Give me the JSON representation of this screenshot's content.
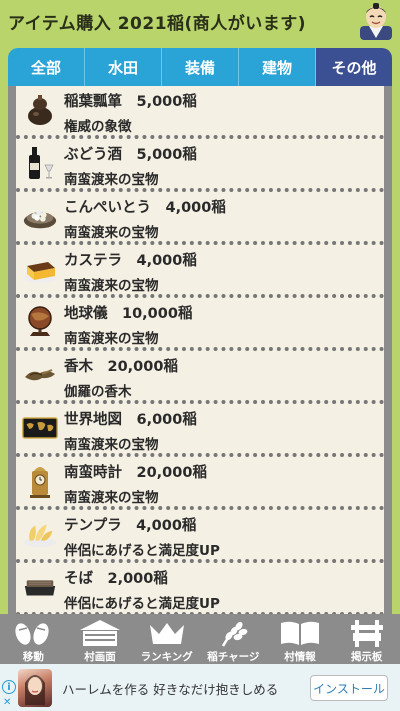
{
  "header": {
    "title": "アイテム購入 2021稲(商人がいます)"
  },
  "tabs": [
    {
      "label": "全部",
      "active": false
    },
    {
      "label": "水田",
      "active": false
    },
    {
      "label": "装備",
      "active": false
    },
    {
      "label": "建物",
      "active": false
    },
    {
      "label": "その他",
      "active": true
    }
  ],
  "items": [
    {
      "name": "稲葉瓢箪　5,000稲",
      "desc": "権威の象徴",
      "icon": "gourd-icon"
    },
    {
      "name": "ぶどう酒　5,000稲",
      "desc": "南蛮渡来の宝物",
      "icon": "wine-icon"
    },
    {
      "name": "こんぺいとう　4,000稲",
      "desc": "南蛮渡来の宝物",
      "icon": "konpeito-icon"
    },
    {
      "name": "カステラ　4,000稲",
      "desc": "南蛮渡来の宝物",
      "icon": "castella-icon"
    },
    {
      "name": "地球儀　10,000稲",
      "desc": "南蛮渡来の宝物",
      "icon": "globe-icon"
    },
    {
      "name": "香木　20,000稲",
      "desc": "伽羅の香木",
      "icon": "incense-wood-icon"
    },
    {
      "name": "世界地図　6,000稲",
      "desc": "南蛮渡来の宝物",
      "icon": "world-map-icon"
    },
    {
      "name": "南蛮時計　20,000稲",
      "desc": "南蛮渡来の宝物",
      "icon": "clock-icon"
    },
    {
      "name": "テンプラ　4,000稲",
      "desc": "伴侶にあげると満足度UP",
      "icon": "tempura-icon"
    },
    {
      "name": "そば　2,000稲",
      "desc": "伴侶にあげると満足度UP",
      "icon": "soba-icon"
    }
  ],
  "nav": [
    {
      "label": "移動",
      "icon": "move-icon"
    },
    {
      "label": "村画面",
      "icon": "village-icon"
    },
    {
      "label": "ランキング",
      "icon": "crown-icon"
    },
    {
      "label": "稲チャージ",
      "icon": "rice-icon"
    },
    {
      "label": "村情報",
      "icon": "book-icon"
    },
    {
      "label": "掲示板",
      "icon": "board-icon"
    }
  ],
  "ad": {
    "text": "ハーレムを作る 好きなだけ抱きしめる",
    "button": "インストール",
    "info": "i",
    "close": "✕"
  }
}
